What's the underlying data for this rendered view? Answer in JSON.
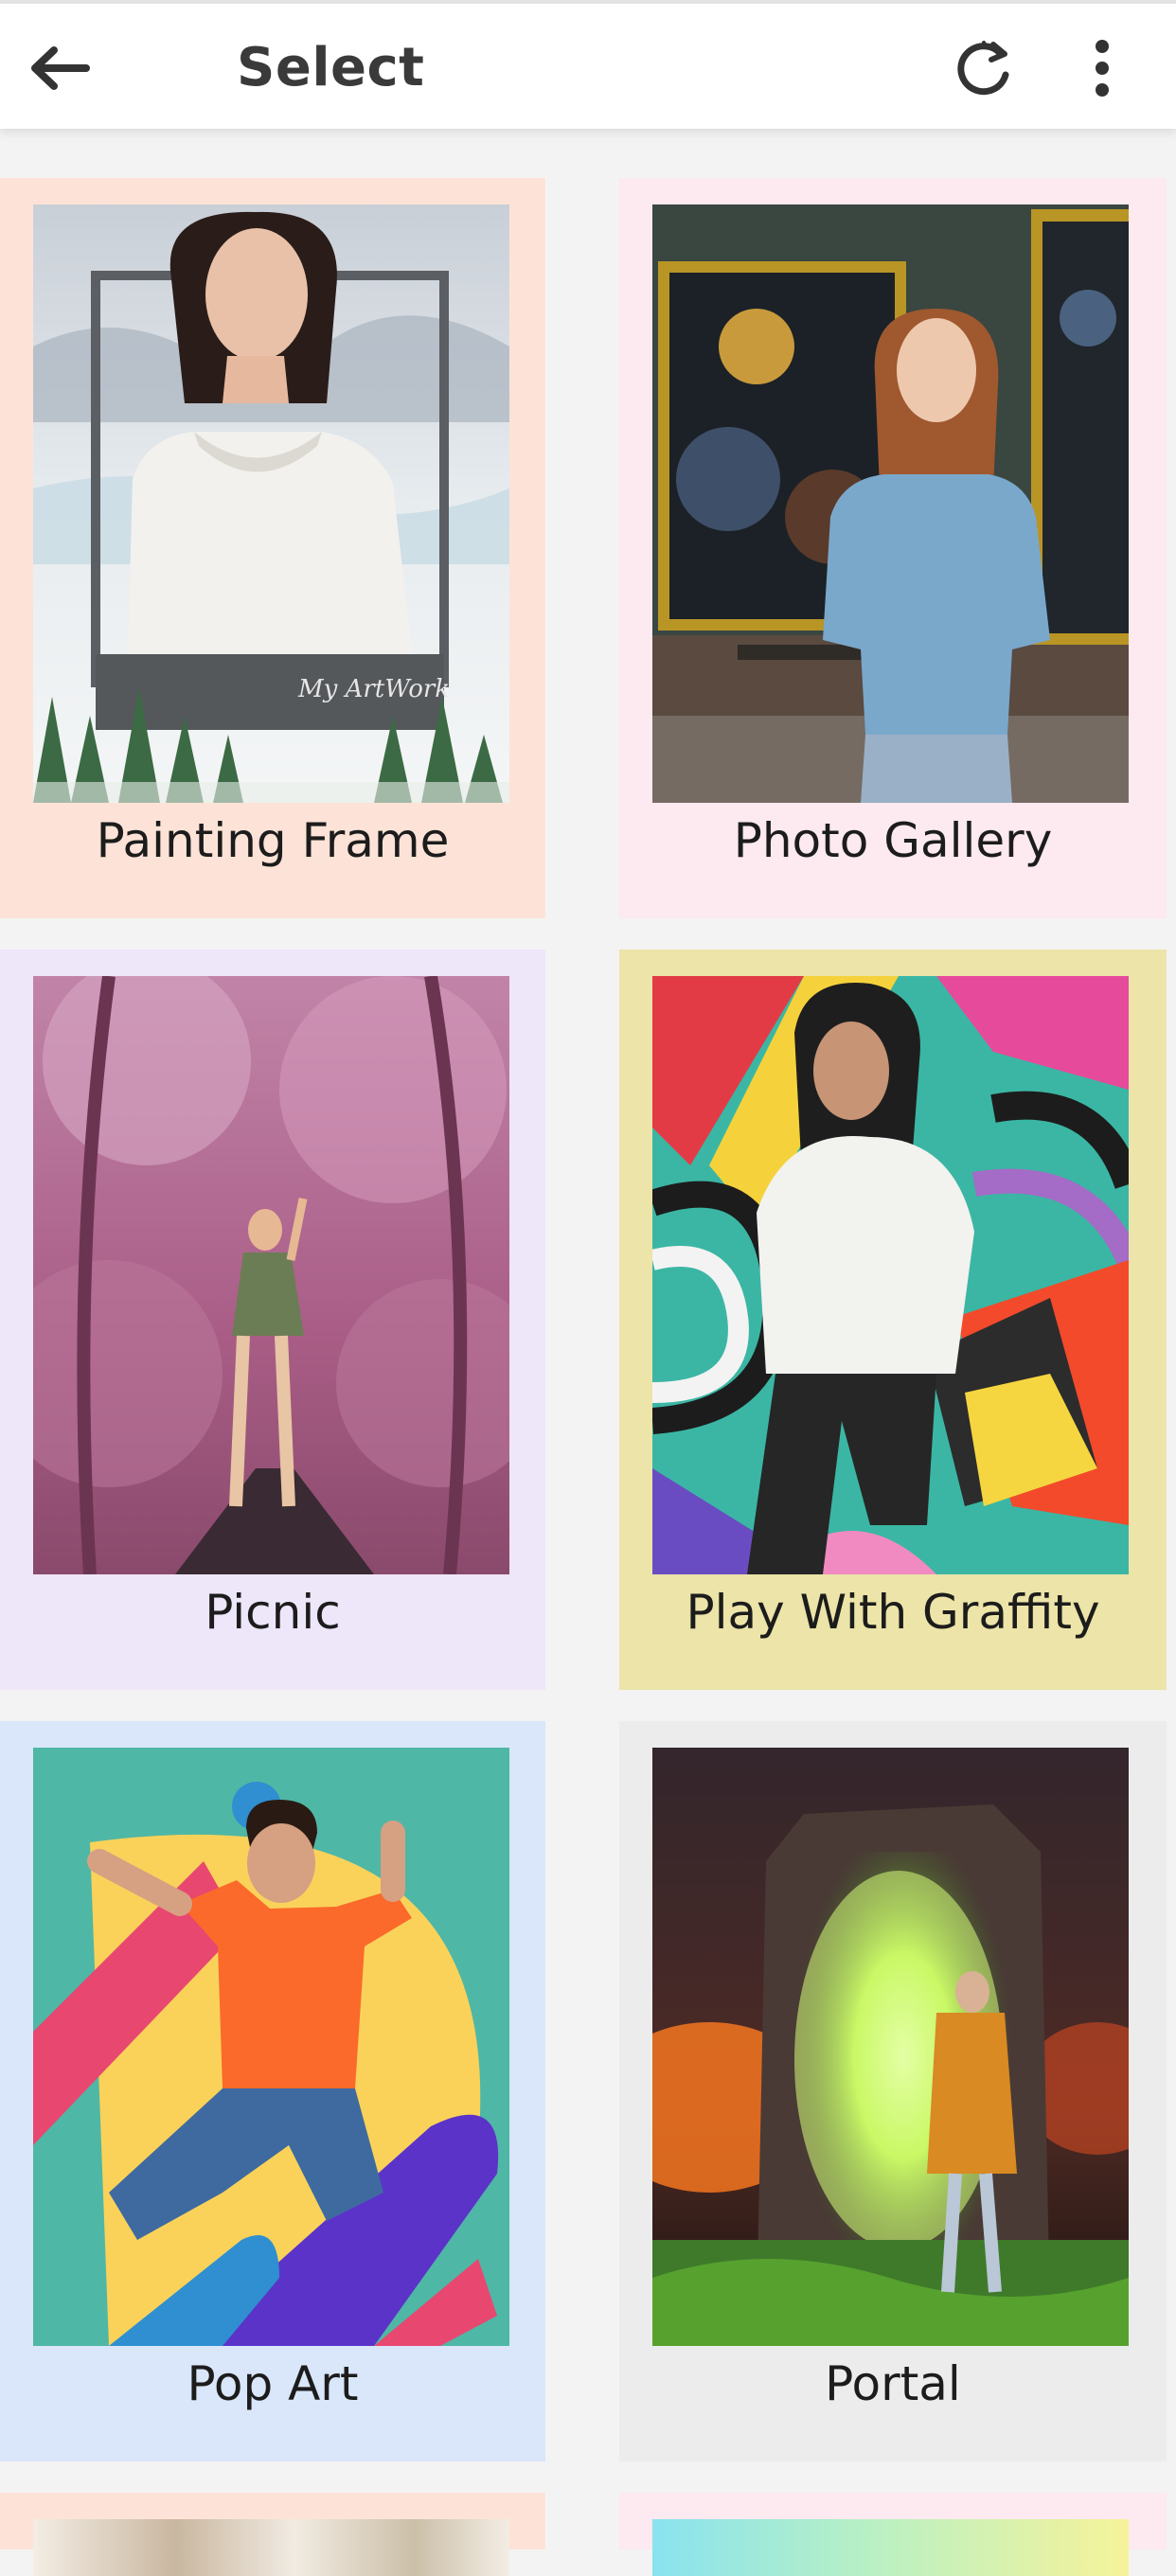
{
  "header": {
    "title": "Select",
    "back_icon": "arrow-left-icon",
    "refresh_icon": "refresh-icon",
    "more_icon": "more-vertical-icon"
  },
  "cards": [
    {
      "label": "Painting Frame",
      "bg": "#fde3d7"
    },
    {
      "label": "Photo Gallery",
      "bg": "#fde9f0"
    },
    {
      "label": "Picnic",
      "bg": "#eee6f9"
    },
    {
      "label": "Play With Graffity",
      "bg": "#ece4a8"
    },
    {
      "label": "Pop Art",
      "bg": "#dae6f9"
    },
    {
      "label": "Portal",
      "bg": "#ececec"
    }
  ]
}
